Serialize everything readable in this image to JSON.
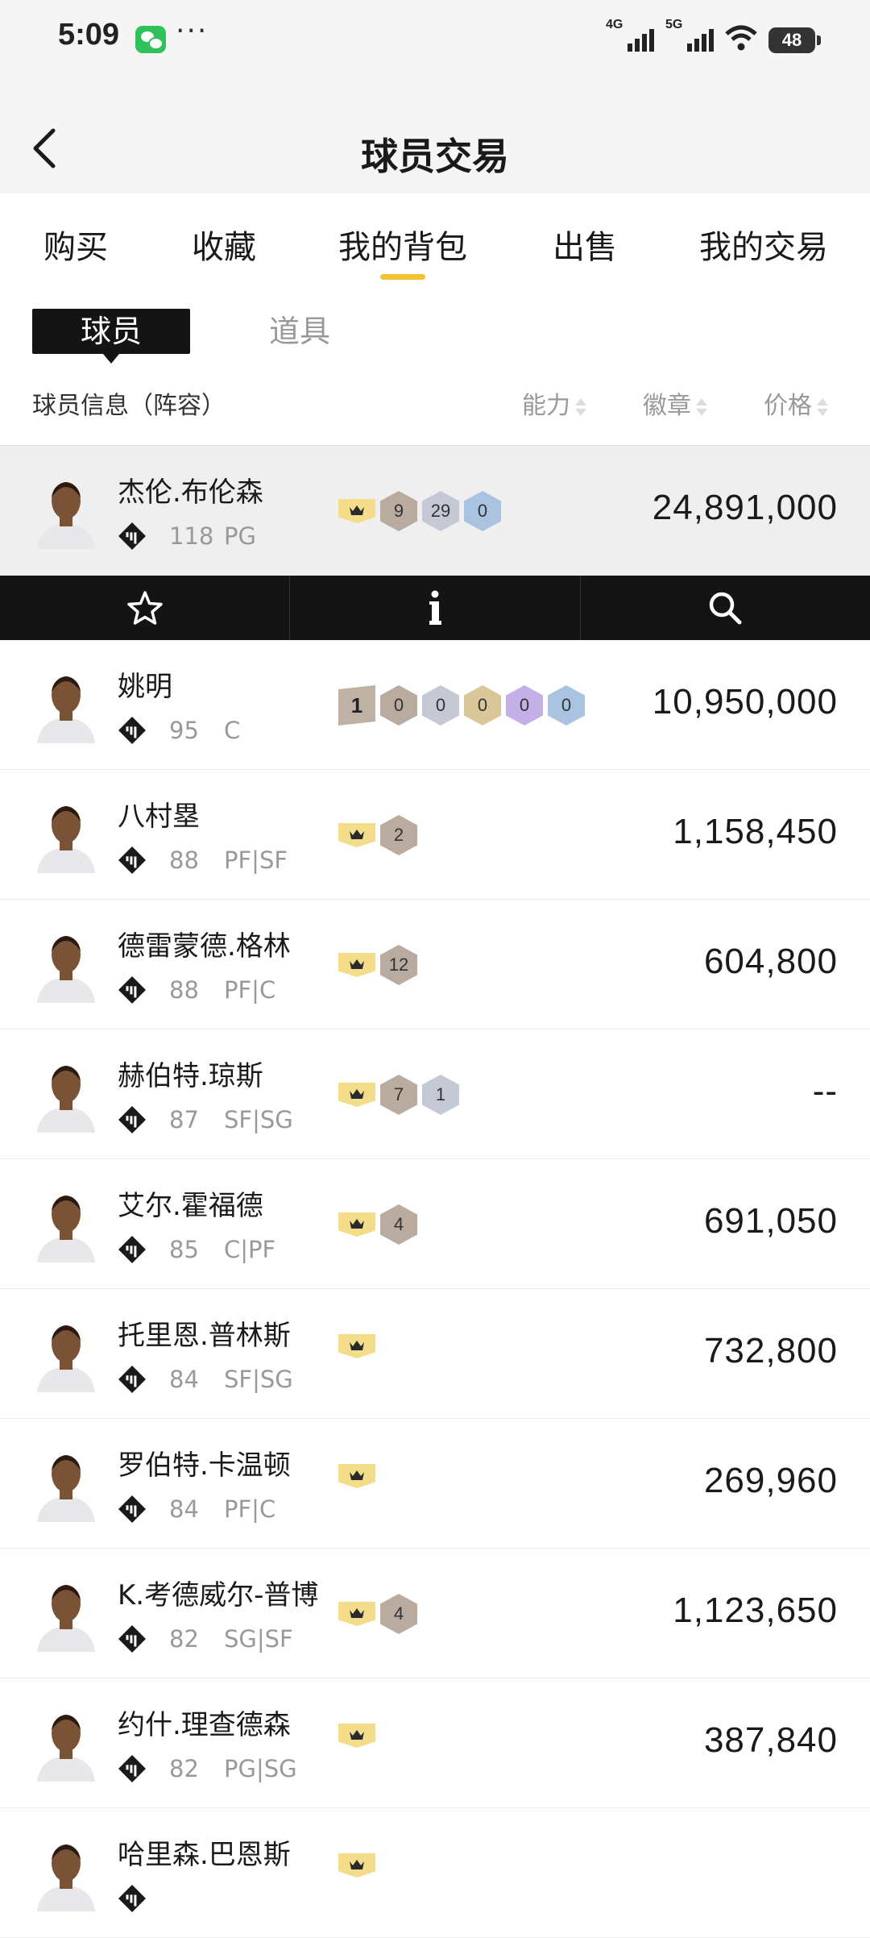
{
  "status_bar": {
    "time": "5:09",
    "dots": "···",
    "net1": "4G",
    "net2": "5G",
    "battery": "48"
  },
  "nav": {
    "title": "球员交易"
  },
  "tabs": [
    {
      "label": "购买"
    },
    {
      "label": "收藏"
    },
    {
      "label": "我的背包"
    },
    {
      "label": "出售"
    },
    {
      "label": "我的交易"
    }
  ],
  "active_tab": "我的背包",
  "subtabs": {
    "active": "球员",
    "inactive": "道具"
  },
  "columns": {
    "info": "球员信息（阵容）",
    "ability": "能力",
    "badges": "徽章",
    "price": "价格"
  },
  "players": [
    {
      "name": "杰伦.布伦森",
      "rating": "118",
      "pos": "PG",
      "price": "24,891,000",
      "badges": [
        {
          "t": "crown"
        },
        {
          "t": "bronze",
          "v": "9"
        },
        {
          "t": "silver",
          "v": "29"
        },
        {
          "t": "blue",
          "v": "0"
        }
      ]
    },
    {
      "name": "姚明",
      "rating": "95",
      "pos": "C",
      "price": "10,950,000",
      "badges": [
        {
          "t": "first",
          "v": "1"
        },
        {
          "t": "bronze",
          "v": "0"
        },
        {
          "t": "silver",
          "v": "0"
        },
        {
          "t": "gold",
          "v": "0"
        },
        {
          "t": "purple",
          "v": "0"
        },
        {
          "t": "blue",
          "v": "0"
        }
      ]
    },
    {
      "name": "八村塁",
      "rating": "88",
      "pos": "PF|SF",
      "price": "1,158,450",
      "badges": [
        {
          "t": "crown"
        },
        {
          "t": "bronze",
          "v": "2"
        }
      ]
    },
    {
      "name": "德雷蒙德.格林",
      "rating": "88",
      "pos": "PF|C",
      "price": "604,800",
      "badges": [
        {
          "t": "crown"
        },
        {
          "t": "bronze",
          "v": "12"
        }
      ]
    },
    {
      "name": "赫伯特.琼斯",
      "rating": "87",
      "pos": "SF|SG",
      "price": "--",
      "badges": [
        {
          "t": "crown"
        },
        {
          "t": "bronze",
          "v": "7"
        },
        {
          "t": "silver",
          "v": "1"
        }
      ]
    },
    {
      "name": "艾尔.霍福德",
      "rating": "85",
      "pos": "C|PF",
      "price": "691,050",
      "badges": [
        {
          "t": "crown"
        },
        {
          "t": "bronze",
          "v": "4"
        }
      ]
    },
    {
      "name": "托里恩.普林斯",
      "rating": "84",
      "pos": "SF|SG",
      "price": "732,800",
      "badges": [
        {
          "t": "crown"
        }
      ]
    },
    {
      "name": "罗伯特.卡温顿",
      "rating": "84",
      "pos": "PF|C",
      "price": "269,960",
      "badges": [
        {
          "t": "crown"
        }
      ]
    },
    {
      "name": "K.考德威尔-普博",
      "rating": "82",
      "pos": "SG|SF",
      "price": "1,123,650",
      "badges": [
        {
          "t": "crown"
        },
        {
          "t": "bronze",
          "v": "4"
        }
      ]
    },
    {
      "name": "约什.理查德森",
      "rating": "82",
      "pos": "PG|SG",
      "price": "387,840",
      "badges": [
        {
          "t": "crown"
        }
      ]
    },
    {
      "name": "哈里森.巴恩斯",
      "rating": "",
      "pos": "",
      "price": "",
      "badges": [
        {
          "t": "crown"
        }
      ]
    }
  ],
  "action_bar": [
    "star-icon",
    "info-icon",
    "search-icon"
  ],
  "colors": {
    "accent": "#f2c230",
    "dark": "#141414",
    "muted": "#999999"
  }
}
